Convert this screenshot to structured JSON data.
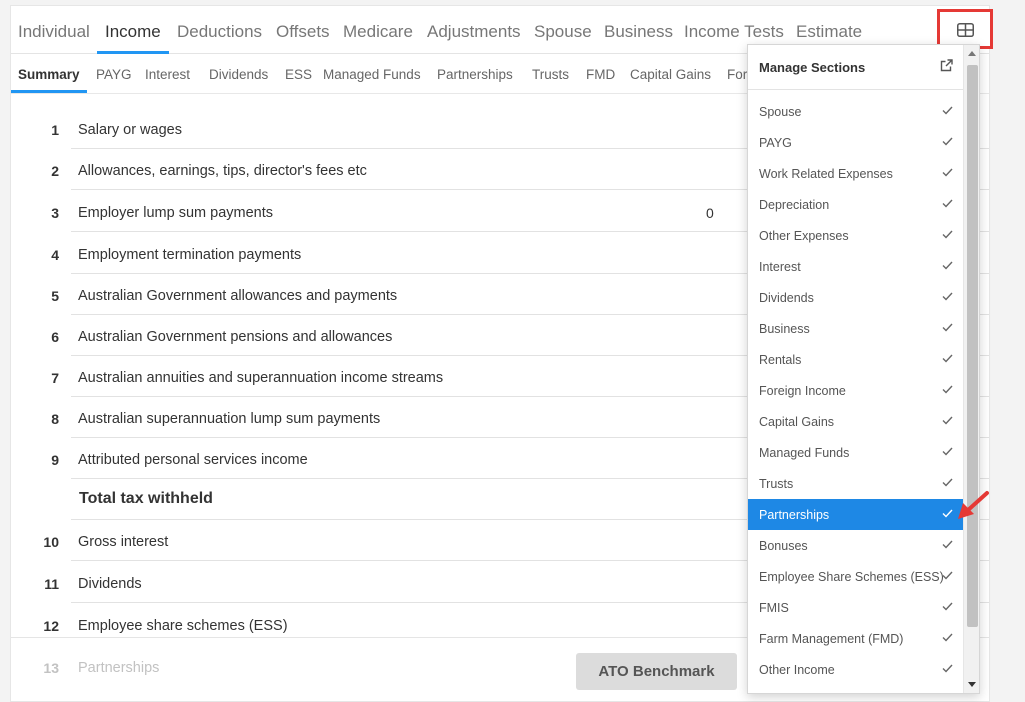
{
  "top_tabs": [
    "Individual",
    "Income",
    "Deductions",
    "Offsets",
    "Medicare",
    "Adjustments",
    "Spouse",
    "Business",
    "Income Tests",
    "Estimate"
  ],
  "sub_tabs": [
    "Summary",
    "PAYG",
    "Interest",
    "Dividends",
    "ESS",
    "Managed Funds",
    "Partnerships",
    "Trusts",
    "FMD",
    "Capital Gains",
    "For"
  ],
  "rows": [
    {
      "num": "1",
      "label": "Salary or wages",
      "value": ""
    },
    {
      "num": "2",
      "label": "Allowances, earnings, tips, director's fees etc",
      "value": ""
    },
    {
      "num": "3",
      "label": "Employer lump sum payments",
      "value": "0"
    },
    {
      "num": "4",
      "label": "Employment termination payments",
      "value": ""
    },
    {
      "num": "5",
      "label": "Australian Government allowances and payments",
      "value": ""
    },
    {
      "num": "6",
      "label": "Australian Government pensions and allowances",
      "value": ""
    },
    {
      "num": "7",
      "label": "Australian annuities and superannuation income streams",
      "value": ""
    },
    {
      "num": "8",
      "label": "Australian superannuation lump sum payments",
      "value": ""
    },
    {
      "num": "9",
      "label": "Attributed personal services income",
      "value": ""
    },
    {
      "num": "",
      "label": "Total tax withheld",
      "value": ""
    },
    {
      "num": "10",
      "label": "Gross interest",
      "value": ""
    },
    {
      "num": "11",
      "label": "Dividends",
      "value": ""
    },
    {
      "num": "12",
      "label": "Employee share schemes (ESS)",
      "value": ""
    },
    {
      "num": "13",
      "label": "Partnerships",
      "value": ""
    }
  ],
  "footer": {
    "ato_benchmark_label": "ATO Benchmark"
  },
  "manage_sections": {
    "title": "Manage Sections",
    "items": [
      "Spouse",
      "PAYG",
      "Work Related Expenses",
      "Depreciation",
      "Other Expenses",
      "Interest",
      "Dividends",
      "Business",
      "Rentals",
      "Foreign Income",
      "Capital Gains",
      "Managed Funds",
      "Trusts",
      "Partnerships",
      "Bonuses",
      "Employee Share Schemes (ESS)",
      "FMIS",
      "Farm Management (FMD)",
      "Other Income"
    ],
    "active_item": "Partnerships"
  },
  "colors": {
    "accent": "#2196f3",
    "highlight": "#1e88e5",
    "annotation": "#e53935"
  },
  "icons": {
    "grid": "grid-icon",
    "external": "external-link-icon",
    "check": "check-icon",
    "arrow": "red-arrow-annotation"
  }
}
